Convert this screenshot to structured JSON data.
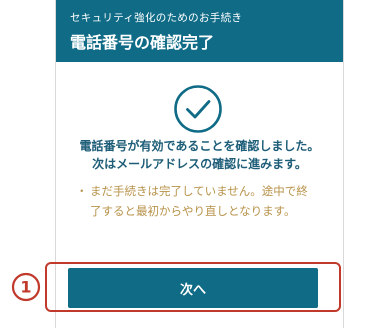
{
  "header": {
    "subtitle": "セキュリティ強化のためのお手続き",
    "title": "電話番号の確認完了"
  },
  "status": {
    "icon": "check-circle-icon",
    "message_line1": "電話番号が有効であることを確認しました。",
    "message_line2": "次はメールアドレスの確認に進みます。"
  },
  "note": {
    "bullet": "・",
    "line1": "まだ手続きは完了していません。途中で終",
    "line2": "了すると最初からやり直しとなります。"
  },
  "actions": {
    "next_label": "次へ"
  },
  "annotation": {
    "step_number": "1"
  },
  "colors": {
    "brand": "#0f6b86",
    "message_text": "#1d5d78",
    "note_text": "#b8934a",
    "highlight": "#c0392b"
  }
}
